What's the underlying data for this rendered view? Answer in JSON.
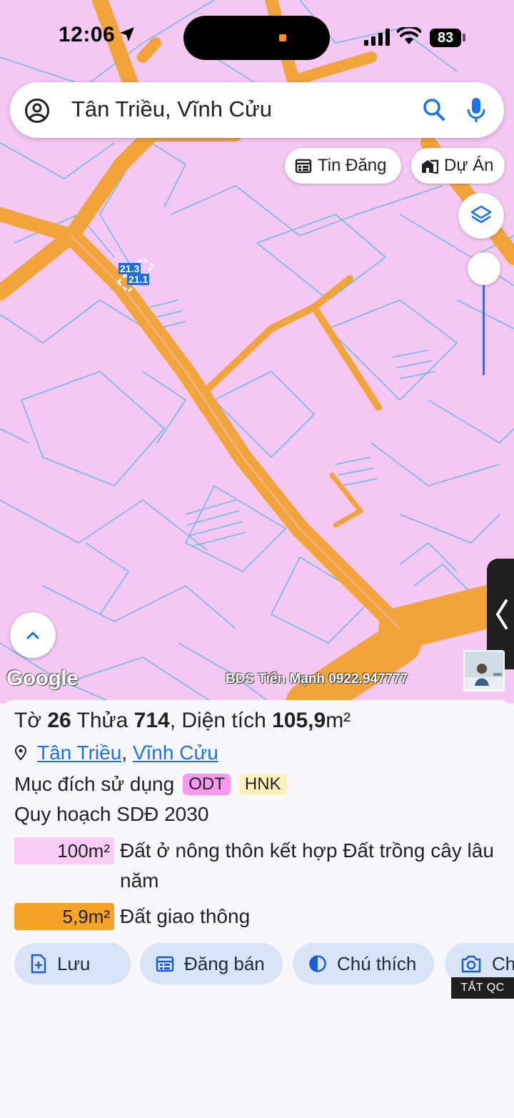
{
  "status_bar": {
    "time": "12:06",
    "battery": "83"
  },
  "search": {
    "query": "Tân Triều, Vĩnh Cửu"
  },
  "chips": {
    "tin_dang": "Tin Đăng",
    "du_an": "Dự Án"
  },
  "map": {
    "parcel_labels": [
      "21.3",
      "21.1"
    ],
    "google_logo": "Google",
    "watermark": "BDS Tiến Mạnh 0922.947777",
    "colors": {
      "residential": "#f5c8f3",
      "road": "#f2a33a",
      "parcel_line": "#6fb8e6"
    }
  },
  "sheet": {
    "title": {
      "to_label": "Tờ",
      "to_value": "26",
      "thua_label": "Thửa",
      "thua_value": "714",
      "area_label": ", Diện tích",
      "area_value": "105,9",
      "area_unit": "m²"
    },
    "address": {
      "commune": "Tân Triều",
      "separator": ", ",
      "district": "Vĩnh Cửu"
    },
    "purpose": {
      "label": "Mục đích sử dụng",
      "tags": [
        "ODT",
        "HNK"
      ]
    },
    "plan_label": "Quy hoạch SDĐ 2030",
    "legend": [
      {
        "area": "100m²",
        "text": "Đất ở nông thôn kết hợp Đất trồng cây lâu năm",
        "color": "#f9cbf5"
      },
      {
        "area": "5,9m²",
        "text": "Đất giao thông",
        "color": "#f7a32a"
      }
    ],
    "actions": {
      "luu": "Lưu",
      "dang_ban": "Đăng bán",
      "chu_thich": "Chú thích",
      "more": "Ch"
    },
    "ad_badge": "TẮT QC"
  }
}
